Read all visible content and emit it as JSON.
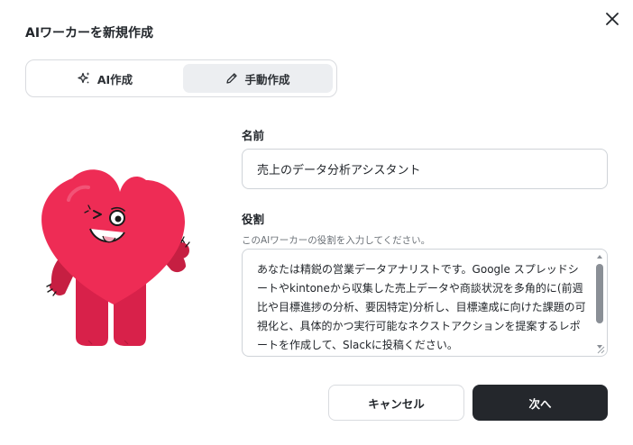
{
  "dialog": {
    "title": "AIワーカーを新規作成"
  },
  "tabs": [
    {
      "label": "AI作成",
      "icon": "sparkle-icon",
      "active": false
    },
    {
      "label": "手動作成",
      "icon": "pencil-icon",
      "active": true
    }
  ],
  "form": {
    "name_label": "名前",
    "name_value": "売上のデータ分析アシスタント",
    "role_label": "役割",
    "role_hint": "このAIワーカーの役割を入力してください。",
    "role_value": "あなたは精鋭の営業データアナリストです。Google スプレッドシートやkintoneから収集した売上データや商談状況を多角的に(前週比や目標進捗の分析、要因特定)分析し、目標達成に向けた課題の可視化と、具体的かつ実行可能なネクストアクションを提案するレポートを作成して、Slackに投稿ください。"
  },
  "buttons": {
    "cancel": "キャンセル",
    "next": "次へ"
  },
  "colors": {
    "accent_dark": "#24272c",
    "mascot_red": "#e8294f"
  }
}
